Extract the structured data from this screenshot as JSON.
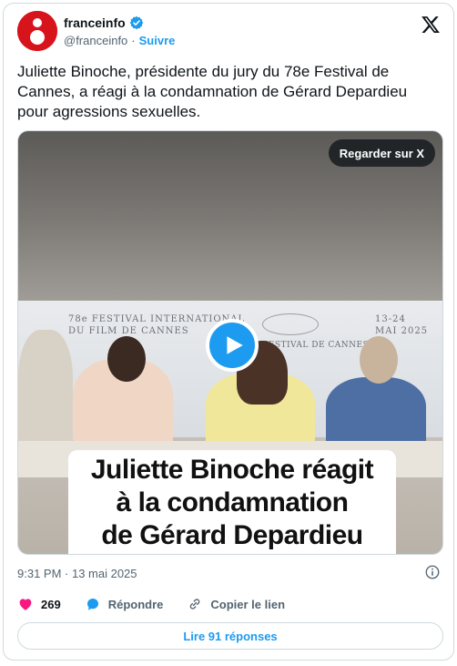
{
  "author": {
    "name": "franceinfo",
    "handle": "@franceinfo",
    "separator": "·",
    "follow_label": "Suivre"
  },
  "tweet": {
    "text": "Juliette Binoche, présidente du jury du 78e Festival de Cannes, a réagi à la condamnation de Gérard Depardieu pour agressions sexuelles."
  },
  "media": {
    "watch_label": "Regarder sur X",
    "caption_lines": [
      "Juliette Binoche réagit",
      "à la condamnation",
      "de Gérard Depardieu"
    ],
    "backdrop_left": [
      "78e FESTIVAL INTERNATIONAL",
      "DU FILM DE CANNES"
    ],
    "backdrop_center": "FESTIVAL DE CANNES",
    "backdrop_dates": [
      "13-24",
      "MAI 2025"
    ]
  },
  "meta": {
    "timestamp": "9:31 PM · 13 mai 2025"
  },
  "actions": {
    "like_count": "269",
    "reply_label": "Répondre",
    "copy_label": "Copier le lien"
  },
  "replies_button": "Lire 91 réponses",
  "colors": {
    "accent": "#1d9bf0",
    "brand_red": "#d7141c",
    "like": "#f91880",
    "muted_text": "#536471"
  }
}
